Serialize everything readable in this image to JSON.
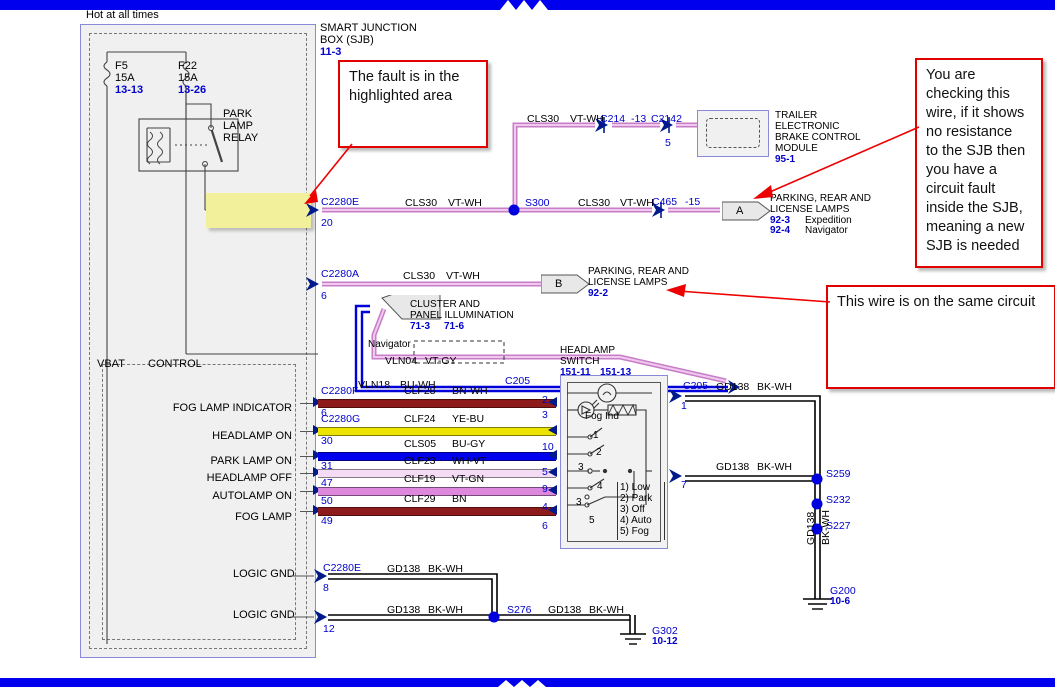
{
  "diagram": {
    "hot_label": "Hot at all times",
    "sjb": {
      "title_line1": "SMART JUNCTION",
      "title_line2": "BOX (SJB)",
      "ref": "11-3"
    },
    "fuses": [
      {
        "id": "F5",
        "rating": "15A",
        "ref": "13-13"
      },
      {
        "id": "F22",
        "rating": "15A",
        "ref": "13-26"
      }
    ],
    "relay": {
      "line1": "PARK",
      "line2": "LAMP",
      "line3": "RELAY"
    },
    "vbat_label": "VBAT",
    "control_label": "CONTROL",
    "trailer_module": {
      "line1": "TRAILER",
      "line2": "ELECTRONIC",
      "line3": "BRAKE CONTROL",
      "line4": "MODULE",
      "ref": "95-1"
    },
    "headlamp_switch": {
      "title1": "HEADLAMP",
      "title2": "SWITCH",
      "ref1": "151-11",
      "ref2": "151-13",
      "fog_ind_label": "Fog Ind",
      "legend": [
        "1) Low",
        "2) Park",
        "3) Off",
        "4) Auto",
        "5) Fog"
      ],
      "contact_nums": [
        "1",
        "2",
        "3",
        "4",
        "3",
        "5"
      ],
      "pin_labels": [
        "2",
        "3",
        "10",
        "5",
        "9",
        "4",
        "6"
      ],
      "out_conn": "C205",
      "out_pins": [
        "1",
        "7"
      ]
    },
    "cluster": {
      "line1": "CLUSTER AND",
      "line2": "PANEL ILLUMINATION",
      "ref1": "71-3",
      "ref2": "71-6",
      "navigator_label": "Navigator",
      "nav_circuit": "VLN04",
      "nav_color": "VT-GY",
      "vln18_circuit": "VLN18",
      "vln18_color": "BU-WH"
    },
    "lamps_a": {
      "line1": "PARKING, REAR AND",
      "line2": "LICENSE LAMPS",
      "ref1": "92-3",
      "name1": "Expedition",
      "ref2": "92-4",
      "name2": "Navigator",
      "tag": "A"
    },
    "lamps_b": {
      "line1": "PARKING, REAR AND",
      "line2": "LICENSE LAMPS",
      "ref": "92-2",
      "tag": "B"
    },
    "top_branch": {
      "circuit": "CLS30",
      "color": "VT-WH",
      "conn1": "C214",
      "conn1_pin": "-13",
      "conn2": "C2142",
      "conn2_pin": "5"
    },
    "main_run": {
      "conn": "C2280E",
      "pin": "20",
      "circuit": "CLS30",
      "color": "VT-WH",
      "splice": "S300",
      "circuit2": "CLS30",
      "color2": "VT-WH",
      "conn_out": "C465",
      "conn_out_pin": "-15"
    },
    "b_run": {
      "conn": "C2280A",
      "pin": "6",
      "circuit": "CLS30",
      "color": "VT-WH"
    },
    "signals": [
      {
        "label": "FOG LAMP INDICATOR",
        "conn": "C2280F",
        "pin": "6",
        "circuit": "CLF28",
        "color": "BN-WH",
        "sw_pin": "2",
        "wire": "#8e1b1b"
      },
      {
        "label": "HEADLAMP ON",
        "conn": "C2280G",
        "pin": "30",
        "circuit": "CLF24",
        "color": "YE-BU",
        "sw_pin": "10",
        "wire": "#ece300"
      },
      {
        "label": "PARK LAMP ON",
        "conn": "",
        "pin": "31",
        "circuit": "CLS05",
        "color": "BU-GY",
        "sw_pin": "5",
        "wire": "#0000ee"
      },
      {
        "label": "HEADLAMP OFF",
        "conn": "",
        "pin": "47",
        "circuit": "CLF23",
        "color": "WH-VT",
        "sw_pin": "9",
        "wire": "#f4dcf4"
      },
      {
        "label": "AUTOLAMP ON",
        "conn": "",
        "pin": "50",
        "circuit": "CLF19",
        "color": "VT-GN",
        "sw_pin": "4",
        "wire": "#dd88dd"
      },
      {
        "label": "FOG LAMP",
        "conn": "",
        "pin": "49",
        "circuit": "CLF29",
        "color": "BN",
        "sw_pin": "6",
        "wire": "#8e1b1b"
      }
    ],
    "grounds_right": {
      "conn": "C205",
      "pin_top": "1",
      "pin_bot": "7",
      "circuit": "GD138",
      "color": "BK-WH",
      "splices": [
        "S259",
        "S232",
        "S227"
      ],
      "vert_circuit": "GD138",
      "vert_color": "BK-WH",
      "ground": "G200",
      "ground_ref": "10-6"
    },
    "grounds_bottom": {
      "label1": "LOGIC GND",
      "label2": "LOGIC GND",
      "conn": "C2280E",
      "pin1": "8",
      "pin2": "12",
      "circuit": "GD138",
      "color": "BK-WH",
      "splice": "S276",
      "ground": "G302",
      "ground_ref": "10-12"
    },
    "callouts": [
      {
        "id": "fault",
        "text": "The fault is in the\nhighlighted area"
      },
      {
        "id": "checking",
        "text": "You are\nchecking this\nwire, if it shows\nno resistance\nto the SJB then\nyou have a\ncircuit fault\ninside the SJB,\nmeaning a new\nSJB is needed"
      },
      {
        "id": "samecircuit",
        "text": "This wire is on the same circuit"
      }
    ],
    "colors": {
      "accent_blue": "#0000cc",
      "callout_red": "#e00000",
      "highlight_yellow": "#f2f09a",
      "bar_blue": "#0000ee",
      "violet_wire": "#e7a8e7"
    }
  }
}
